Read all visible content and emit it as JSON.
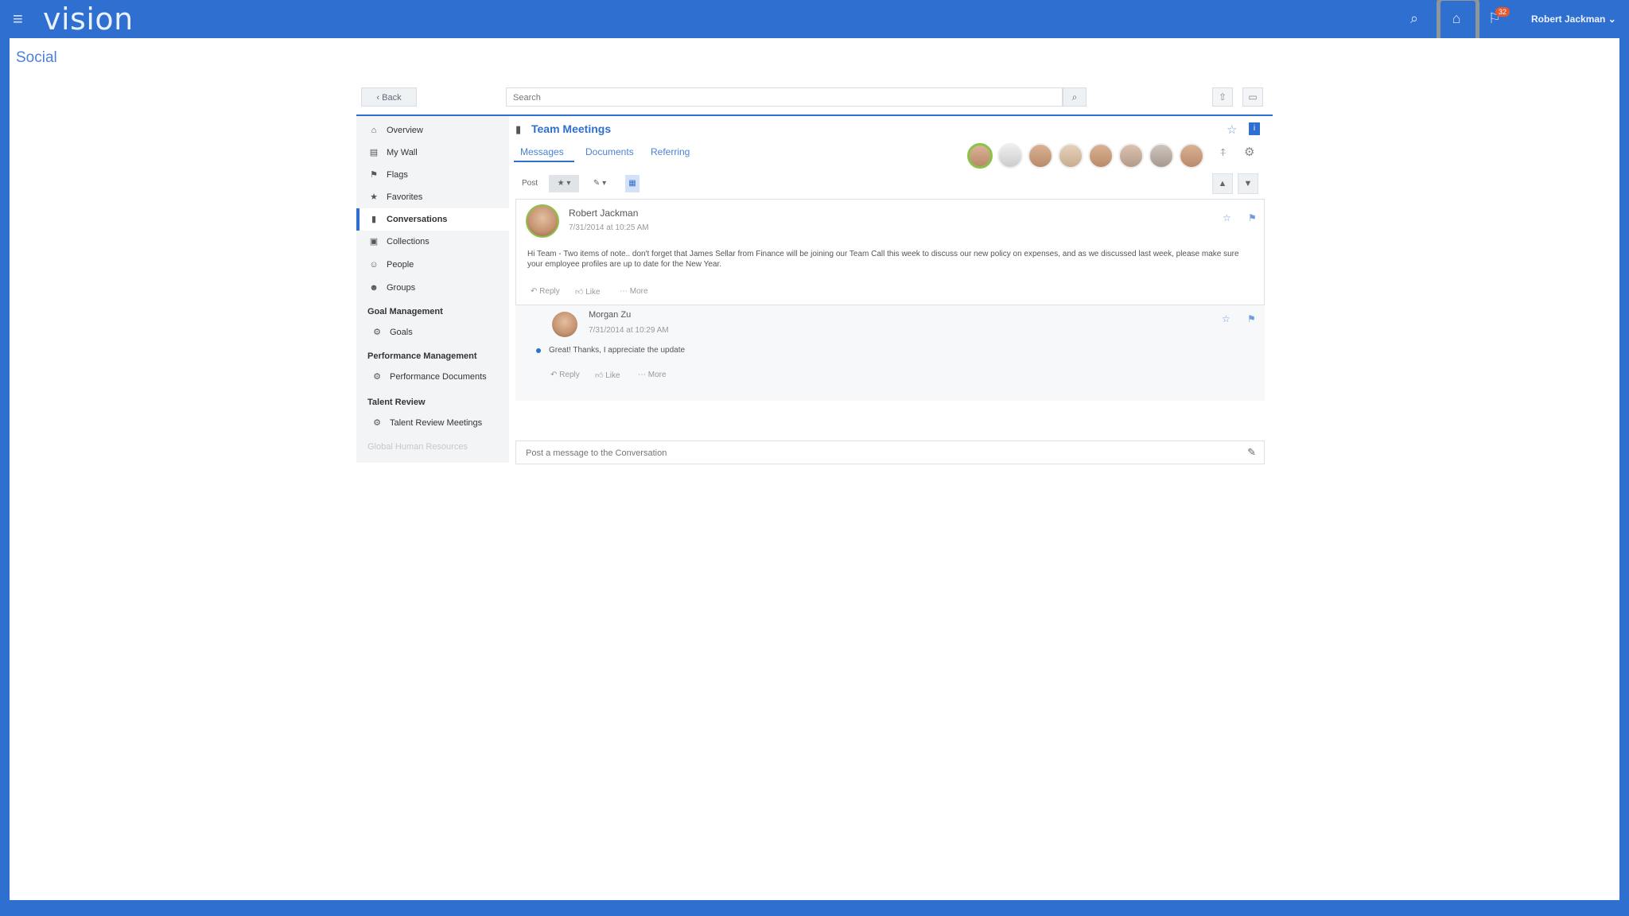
{
  "app": {
    "logo": "vision",
    "user_name": "Robert Jackman ⌄",
    "notification_count": "32",
    "page_title": "Social"
  },
  "toolbar": {
    "back_label": "‹  Back",
    "search_placeholder": "Search"
  },
  "sidebar": {
    "items": [
      {
        "label": "Overview",
        "icon": "home-icon",
        "glyph": "⌂"
      },
      {
        "label": "My Wall",
        "icon": "wall-icon",
        "glyph": "▤"
      },
      {
        "label": "Flags",
        "icon": "flag-icon",
        "glyph": "⚑"
      },
      {
        "label": "Favorites",
        "icon": "star-icon",
        "glyph": "★"
      },
      {
        "label": "Conversations",
        "icon": "chat-icon",
        "glyph": "▮"
      },
      {
        "label": "Collections",
        "icon": "collections-icon",
        "glyph": "▣"
      },
      {
        "label": "People",
        "icon": "people-icon",
        "glyph": "☺"
      },
      {
        "label": "Groups",
        "icon": "groups-icon",
        "glyph": "☻"
      }
    ],
    "sections": [
      {
        "heading": "Goal Management",
        "item": "Goals"
      },
      {
        "heading": "Performance Management",
        "item": "Performance Documents"
      },
      {
        "heading": "Talent Review",
        "item": "Talent Review Meetings"
      }
    ],
    "faded_item": "Global Human Resources"
  },
  "conversation": {
    "title": "Team Meetings",
    "tabs": [
      "Messages",
      "Documents",
      "Referring"
    ],
    "filter_label": "Post"
  },
  "posts": [
    {
      "author": "Robert Jackman",
      "timestamp": "7/31/2014 at 10:25 AM",
      "text": "Hi Team - Two items of note.. don't forget that James Sellar from Finance will be joining our Team Call this week to discuss our new policy on expenses, and as we discussed last week, please make sure your employee profiles are up to date for the New Year.",
      "actions": [
        "Reply",
        "Like",
        "More"
      ]
    },
    {
      "author": "Morgan Zu",
      "timestamp": "7/31/2014 at 10:29 AM",
      "text": "Great! Thanks, I appreciate the update",
      "actions": [
        "Reply",
        "Like",
        "More"
      ]
    }
  ],
  "composer": {
    "placeholder": "Post a message to the Conversation"
  }
}
